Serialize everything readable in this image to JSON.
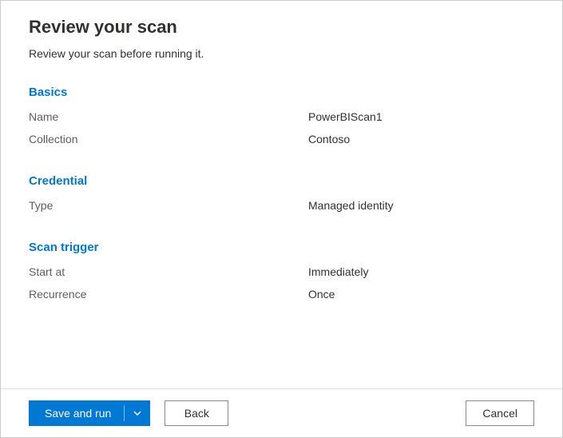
{
  "header": {
    "title": "Review your scan",
    "subtitle": "Review your scan before running it."
  },
  "sections": {
    "basics": {
      "heading": "Basics",
      "nameLabel": "Name",
      "nameValue": "PowerBIScan1",
      "collectionLabel": "Collection",
      "collectionValue": "Contoso"
    },
    "credential": {
      "heading": "Credential",
      "typeLabel": "Type",
      "typeValue": "Managed identity"
    },
    "scanTrigger": {
      "heading": "Scan trigger",
      "startAtLabel": "Start at",
      "startAtValue": "Immediately",
      "recurrenceLabel": "Recurrence",
      "recurrenceValue": "Once"
    }
  },
  "footer": {
    "saveAndRun": "Save and run",
    "back": "Back",
    "cancel": "Cancel"
  }
}
